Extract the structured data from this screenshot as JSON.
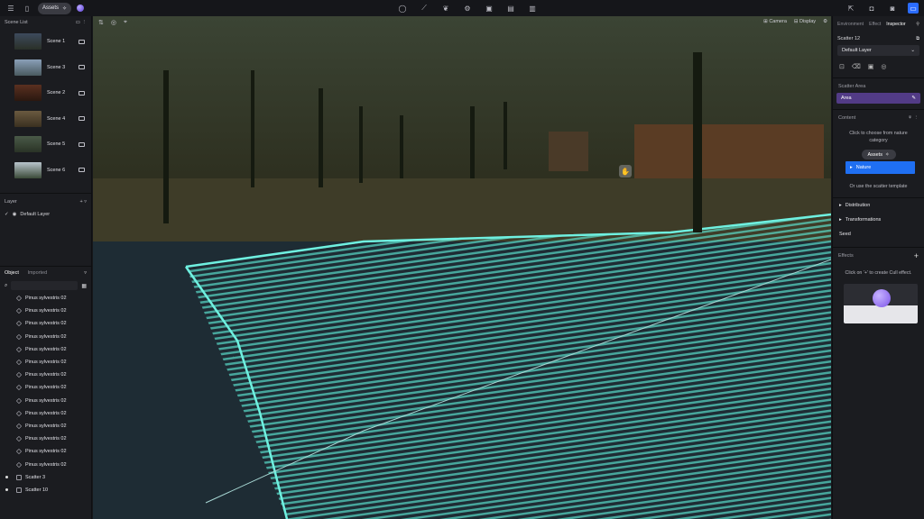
{
  "topbar": {
    "assets_label": "Assets",
    "left_icons": [
      "menu-icon",
      "file-icon"
    ],
    "center_icons": [
      "balloon-icon",
      "nodes-icon",
      "leaf-icon",
      "gear-icon",
      "cube-icon",
      "panel-icon",
      "film-icon"
    ],
    "right_icons": [
      "share-icon",
      "camera-icon",
      "camera-alt-icon",
      "window-icon"
    ]
  },
  "scene_list": {
    "title": "Scene List",
    "scenes": [
      {
        "label": "Scene 1"
      },
      {
        "label": "Scene 3"
      },
      {
        "label": "Scene 2"
      },
      {
        "label": "Scene 4"
      },
      {
        "label": "Scene 5"
      },
      {
        "label": "Scene 6"
      }
    ]
  },
  "layer": {
    "title": "Layer",
    "default_layer": "Default Layer"
  },
  "objects": {
    "tab_object": "Object",
    "tab_imported": "Imported",
    "items": [
      "Pinus sylvestris 02",
      "Pinus sylvestris 02",
      "Pinus sylvestris 02",
      "Pinus sylvestris 02",
      "Pinus sylvestris 02",
      "Pinus sylvestris 02",
      "Pinus sylvestris 02",
      "Pinus sylvestris 02",
      "Pinus sylvestris 02",
      "Pinus sylvestris 02",
      "Pinus sylvestris 02",
      "Pinus sylvestris 02",
      "Pinus sylvestris 02",
      "Pinus sylvestris 02"
    ],
    "scatter_items": [
      "Scatter 3",
      "Scatter 10"
    ]
  },
  "viewport": {
    "camera_label": "Camera",
    "display_label": "Display"
  },
  "inspector": {
    "tabs": [
      "Environment",
      "Effect",
      "Inspector"
    ],
    "active_tab": "Inspector",
    "object_name": "Scatter 12",
    "layer_value": "Default Layer",
    "scatter_area_title": "Scatter Area",
    "area_label": "Area",
    "content_title": "Content",
    "content_hint": "Click to choose from nature category",
    "assets_tip": "Assets",
    "nature_label": "Nature",
    "template_hint": "Or use the scatter template",
    "distribution": "Distribution",
    "transformations": "Transformations",
    "seed": "Seed",
    "effects_title": "Effects",
    "effects_hint": "Click on '+' to create Cull effect."
  },
  "colors": {
    "accent_blue": "#1f6ff2",
    "area_purple": "#523b86",
    "scatter_outline": "#6ff0e0"
  }
}
